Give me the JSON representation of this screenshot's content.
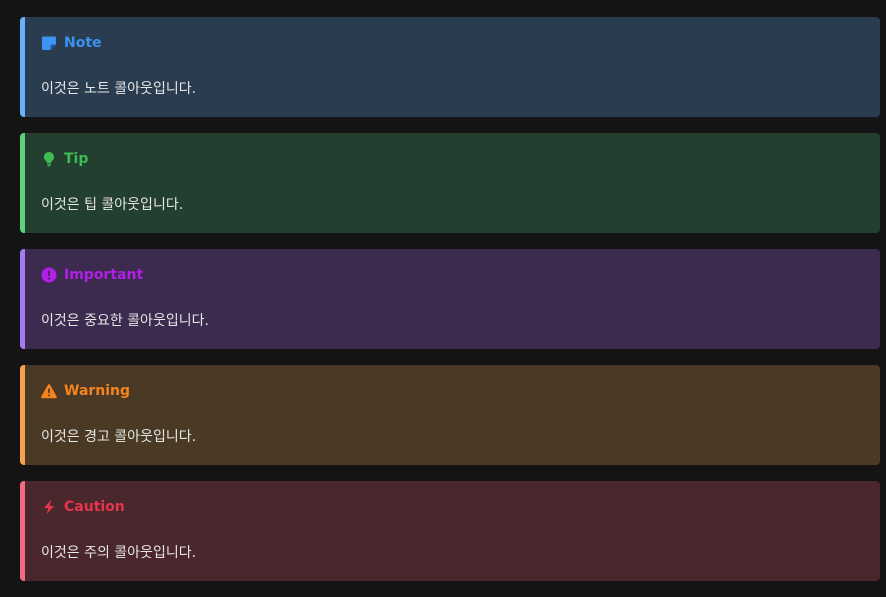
{
  "callouts": [
    {
      "type": "note",
      "icon": "note-icon",
      "color": "#3b93f3",
      "title": "Note",
      "body": "이것은 노트 콜아웃입니다."
    },
    {
      "type": "tip",
      "icon": "lightbulb-icon",
      "color": "#3fbb53",
      "title": "Tip",
      "body": "이것은 팁 콜아웃입니다."
    },
    {
      "type": "important",
      "icon": "exclamation-circle-icon",
      "color": "#b220e8",
      "title": "Important",
      "body": "이것은 중요한 콜아웃입니다."
    },
    {
      "type": "warning",
      "icon": "warning-triangle-icon",
      "color": "#f5841f",
      "title": "Warning",
      "body": "이것은 경고 콜아웃입니다."
    },
    {
      "type": "caution",
      "icon": "lightning-bolt-icon",
      "color": "#e6354c",
      "title": "Caution",
      "body": "이것은 주의 콜아웃입니다."
    }
  ]
}
